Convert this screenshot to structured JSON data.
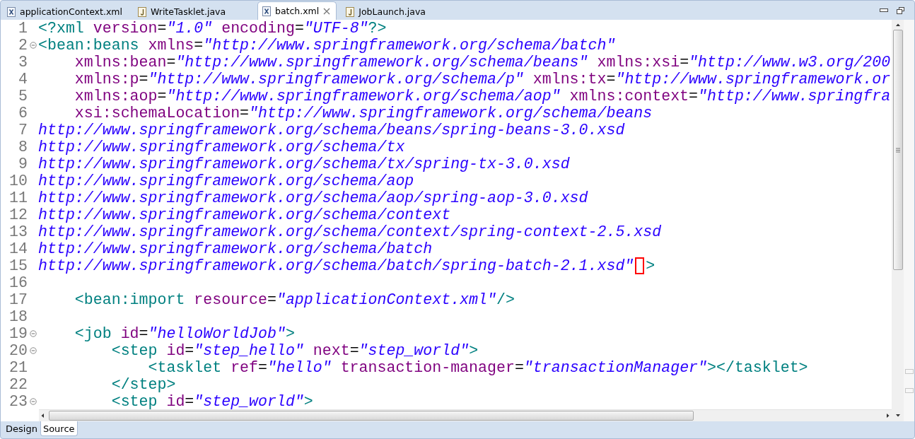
{
  "editor_tabs": [
    {
      "label": "applicationContext.xml",
      "kind": "xml",
      "selected": false,
      "closable": false
    },
    {
      "label": "WriteTasklet.java",
      "kind": "java",
      "selected": false,
      "closable": false
    },
    {
      "label": "batch.xml",
      "kind": "xml",
      "selected": true,
      "closable": true
    },
    {
      "label": "JobLaunch.java",
      "kind": "java",
      "selected": false,
      "closable": false
    }
  ],
  "lines": [
    {
      "number": "1",
      "folding": false,
      "tokens": [
        {
          "kind": "tag",
          "text": "<?xml"
        },
        {
          "kind": "attr",
          "text": " version"
        },
        {
          "kind": "plain",
          "text": "="
        },
        {
          "kind": "string",
          "text": "\"1.0\""
        },
        {
          "kind": "attr",
          "text": " encoding"
        },
        {
          "kind": "plain",
          "text": "="
        },
        {
          "kind": "string",
          "text": "\"UTF-8\""
        },
        {
          "kind": "tag",
          "text": "?>"
        }
      ]
    },
    {
      "number": "2",
      "folding": true,
      "tokens": [
        {
          "kind": "tag",
          "text": "<bean:beans"
        },
        {
          "kind": "attr",
          "text": " xmlns"
        },
        {
          "kind": "plain",
          "text": "="
        },
        {
          "kind": "string",
          "text": "\"http://www.springframework.org/schema/batch\""
        }
      ]
    },
    {
      "number": "3",
      "folding": false,
      "tokens": [
        {
          "kind": "attr",
          "text": "    xmlns:bean"
        },
        {
          "kind": "plain",
          "text": "="
        },
        {
          "kind": "string",
          "text": "\"http://www.springframework.org/schema/beans\""
        },
        {
          "kind": "attr",
          "text": " xmlns:xsi"
        },
        {
          "kind": "plain",
          "text": "="
        },
        {
          "kind": "string",
          "text": "\"http://www.w3.org/200"
        }
      ]
    },
    {
      "number": "4",
      "folding": false,
      "tokens": [
        {
          "kind": "attr",
          "text": "    xmlns:p"
        },
        {
          "kind": "plain",
          "text": "="
        },
        {
          "kind": "string",
          "text": "\"http://www.springframework.org/schema/p\""
        },
        {
          "kind": "attr",
          "text": " xmlns:tx"
        },
        {
          "kind": "plain",
          "text": "="
        },
        {
          "kind": "string",
          "text": "\"http://www.springframework.or"
        }
      ]
    },
    {
      "number": "5",
      "folding": false,
      "tokens": [
        {
          "kind": "attr",
          "text": "    xmlns:aop"
        },
        {
          "kind": "plain",
          "text": "="
        },
        {
          "kind": "string",
          "text": "\"http://www.springframework.org/schema/aop\""
        },
        {
          "kind": "attr",
          "text": " xmlns:context"
        },
        {
          "kind": "plain",
          "text": "="
        },
        {
          "kind": "string",
          "text": "\"http://www.springfra"
        }
      ]
    },
    {
      "number": "6",
      "folding": false,
      "tokens": [
        {
          "kind": "attr",
          "text": "    xsi:schemaLocation"
        },
        {
          "kind": "plain",
          "text": "="
        },
        {
          "kind": "string",
          "text": "\"http://www.springframework.org/schema/beans"
        }
      ]
    },
    {
      "number": "7",
      "folding": false,
      "tokens": [
        {
          "kind": "string",
          "text": "http://www.springframework.org/schema/beans/spring-beans-3.0.xsd"
        }
      ]
    },
    {
      "number": "8",
      "folding": false,
      "tokens": [
        {
          "kind": "string",
          "text": "http://www.springframework.org/schema/tx"
        }
      ]
    },
    {
      "number": "9",
      "folding": false,
      "tokens": [
        {
          "kind": "string",
          "text": "http://www.springframework.org/schema/tx/spring-tx-3.0.xsd"
        }
      ]
    },
    {
      "number": "10",
      "folding": false,
      "tokens": [
        {
          "kind": "string",
          "text": "http://www.springframework.org/schema/aop"
        }
      ]
    },
    {
      "number": "11",
      "folding": false,
      "tokens": [
        {
          "kind": "string",
          "text": "http://www.springframework.org/schema/aop/spring-aop-3.0.xsd"
        }
      ]
    },
    {
      "number": "12",
      "folding": false,
      "tokens": [
        {
          "kind": "string",
          "text": "http://www.springframework.org/schema/context"
        }
      ]
    },
    {
      "number": "13",
      "folding": false,
      "tokens": [
        {
          "kind": "string",
          "text": "http://www.springframework.org/schema/context/spring-context-2.5.xsd"
        }
      ]
    },
    {
      "number": "14",
      "folding": false,
      "tokens": [
        {
          "kind": "string",
          "text": "http://www.springframework.org/schema/batch"
        }
      ]
    },
    {
      "number": "15",
      "folding": false,
      "tokens": [
        {
          "kind": "string",
          "text": "http://www.springframework.org/schema/batch/spring-batch-2.1.xsd\""
        },
        {
          "kind": "tag",
          "text": ">",
          "marked_before": true
        }
      ]
    },
    {
      "number": "16",
      "folding": false
    },
    {
      "number": "17",
      "folding": false,
      "tokens": [
        {
          "kind": "tag",
          "text": "    <bean:import"
        },
        {
          "kind": "attr",
          "text": " resource"
        },
        {
          "kind": "plain",
          "text": "="
        },
        {
          "kind": "string",
          "text": "\"applicationContext.xml\""
        },
        {
          "kind": "tag",
          "text": "/>"
        }
      ]
    },
    {
      "number": "18",
      "folding": false
    },
    {
      "number": "19",
      "folding": true,
      "tokens": [
        {
          "kind": "tag",
          "text": "    <job"
        },
        {
          "kind": "attr",
          "text": " id"
        },
        {
          "kind": "plain",
          "text": "="
        },
        {
          "kind": "string",
          "text": "\"helloWorldJob\""
        },
        {
          "kind": "tag",
          "text": ">"
        }
      ]
    },
    {
      "number": "20",
      "folding": true,
      "tokens": [
        {
          "kind": "tag",
          "text": "        <step"
        },
        {
          "kind": "attr",
          "text": " id"
        },
        {
          "kind": "plain",
          "text": "="
        },
        {
          "kind": "string",
          "text": "\"step_hello\""
        },
        {
          "kind": "attr",
          "text": " next"
        },
        {
          "kind": "plain",
          "text": "="
        },
        {
          "kind": "string",
          "text": "\"step_world\""
        },
        {
          "kind": "tag",
          "text": ">"
        }
      ]
    },
    {
      "number": "21",
      "folding": false,
      "tokens": [
        {
          "kind": "tag",
          "text": "            <tasklet"
        },
        {
          "kind": "attr",
          "text": " ref"
        },
        {
          "kind": "plain",
          "text": "="
        },
        {
          "kind": "string",
          "text": "\"hello\""
        },
        {
          "kind": "attr",
          "text": " transaction-manager"
        },
        {
          "kind": "plain",
          "text": "="
        },
        {
          "kind": "string",
          "text": "\"transactionManager\""
        },
        {
          "kind": "tag",
          "text": "></tasklet>"
        }
      ]
    },
    {
      "number": "22",
      "folding": false,
      "tokens": [
        {
          "kind": "tag",
          "text": "        </step>"
        }
      ]
    },
    {
      "number": "23",
      "folding": true,
      "tokens": [
        {
          "kind": "tag",
          "text": "        <step"
        },
        {
          "kind": "attr",
          "text": " id"
        },
        {
          "kind": "plain",
          "text": "="
        },
        {
          "kind": "string",
          "text": "\"step_world\""
        },
        {
          "kind": "tag",
          "text": ">"
        }
      ]
    }
  ],
  "page_tabs": [
    {
      "label": "Design",
      "selected": false
    },
    {
      "label": "Source",
      "selected": true
    }
  ]
}
